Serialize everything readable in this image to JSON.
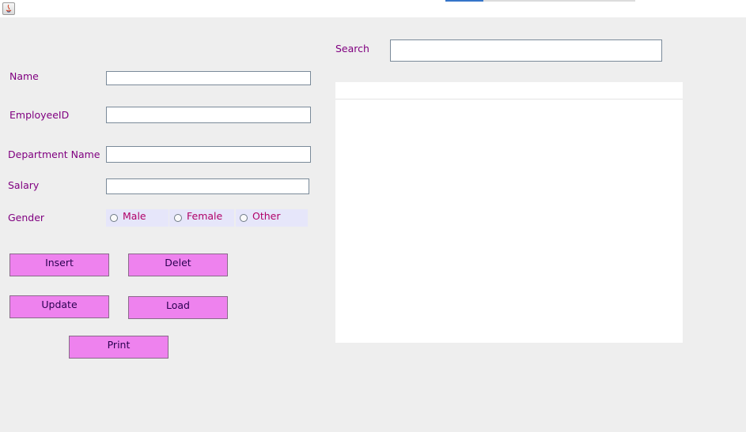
{
  "window": {
    "icon": "java-icon"
  },
  "form": {
    "name_label": "Name",
    "employee_id_label": "EmployeeID",
    "department_label": "Department Name",
    "salary_label": "Salary",
    "gender_label": "Gender",
    "name_value": "",
    "employee_id_value": "",
    "department_value": "",
    "salary_value": "",
    "gender_options": [
      {
        "label": "Male",
        "selected": false
      },
      {
        "label": "Female",
        "selected": false
      },
      {
        "label": "Other",
        "selected": false
      }
    ]
  },
  "buttons": {
    "insert": "Insert",
    "delete": "Delet",
    "update": "Update",
    "load": "Load",
    "print": "Print"
  },
  "search": {
    "label": "Search",
    "value": ""
  },
  "table": {
    "columns": [],
    "rows": []
  },
  "colors": {
    "label_text": "#800080",
    "radio_text": "#b00068",
    "button_bg": "#ee82ee",
    "radio_bg": "#e6e6fa",
    "panel_bg": "#eeeeee"
  }
}
